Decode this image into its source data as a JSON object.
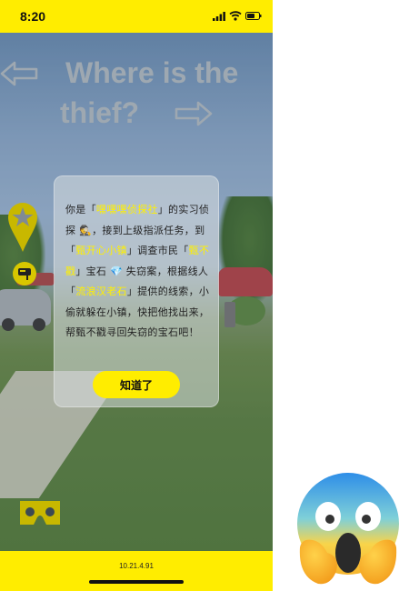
{
  "status_bar": {
    "time": "8:20",
    "bg_color": "#ffed00"
  },
  "scene": {
    "title_line1": "Where is the",
    "title_line2": "thief?",
    "arrow_left_icon": "arrow-left-icon",
    "arrow_right_icon": "arrow-right-icon",
    "map_pin_icon": "map-pin-star-icon",
    "small_icon": "mailbox-icon",
    "vr_icon": "vr-headset-icon"
  },
  "dialog": {
    "message": [
      {
        "text": "你是「",
        "hl": false
      },
      {
        "text": "嘿嘿嘿侦探社",
        "hl": true
      },
      {
        "text": "」的实习侦探 🕵️，接到上级指派任务，到「",
        "hl": false
      },
      {
        "text": "甄开心小镇",
        "hl": true
      },
      {
        "text": "」调查市民「",
        "hl": false
      },
      {
        "text": "甄不戳",
        "hl": true
      },
      {
        "text": "」宝石 💎 失窃案，根据线人「",
        "hl": false
      },
      {
        "text": "流浪汉老石",
        "hl": true
      },
      {
        "text": "」提供的线索，小偷就躲在小镇，快把他找出来，帮甄不戳寻回失窃的宝石吧！",
        "hl": false
      }
    ],
    "ok_label": "知道了",
    "highlight_color": "#fff000"
  },
  "bottom_bar": {
    "version": "10.21.4.91"
  },
  "decor": {
    "emoji_icon": "face-screaming-in-fear-emoji"
  }
}
